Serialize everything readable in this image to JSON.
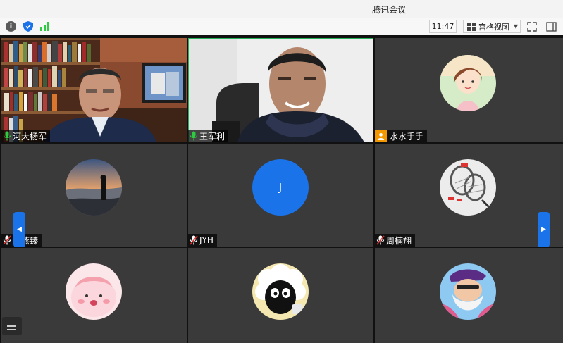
{
  "window": {
    "title": "腾讯会议"
  },
  "toolbar": {
    "info_icon": "info-icon",
    "shield_icon": "shield-icon",
    "signal_icon": "signal-icon",
    "time": "11:47",
    "view_label": "宫格视图",
    "fullscreen_icon": "fullscreen-icon",
    "sidebar_icon": "sidebar-toggle-icon"
  },
  "participants": [
    {
      "name": "河大杨军",
      "video": true,
      "mic": "on"
    },
    {
      "name": "王军利",
      "video": true,
      "mic": "on",
      "speaking": true
    },
    {
      "name": "水水手手",
      "video": false,
      "mic": "host-badge"
    },
    {
      "name": "申燕臻",
      "video": false,
      "mic": "muted"
    },
    {
      "name": "JYH",
      "video": false,
      "mic": "muted",
      "initial": "J"
    },
    {
      "name": "周楠翔",
      "video": false,
      "mic": "muted"
    },
    {
      "name": "",
      "video": false
    },
    {
      "name": "",
      "video": false
    },
    {
      "name": "",
      "video": false
    }
  ],
  "colors": {
    "accent": "#1a73e8",
    "speaking_border": "#25b05a",
    "tile_bg": "#3a3a3a",
    "mic_green": "#2ecc40"
  }
}
